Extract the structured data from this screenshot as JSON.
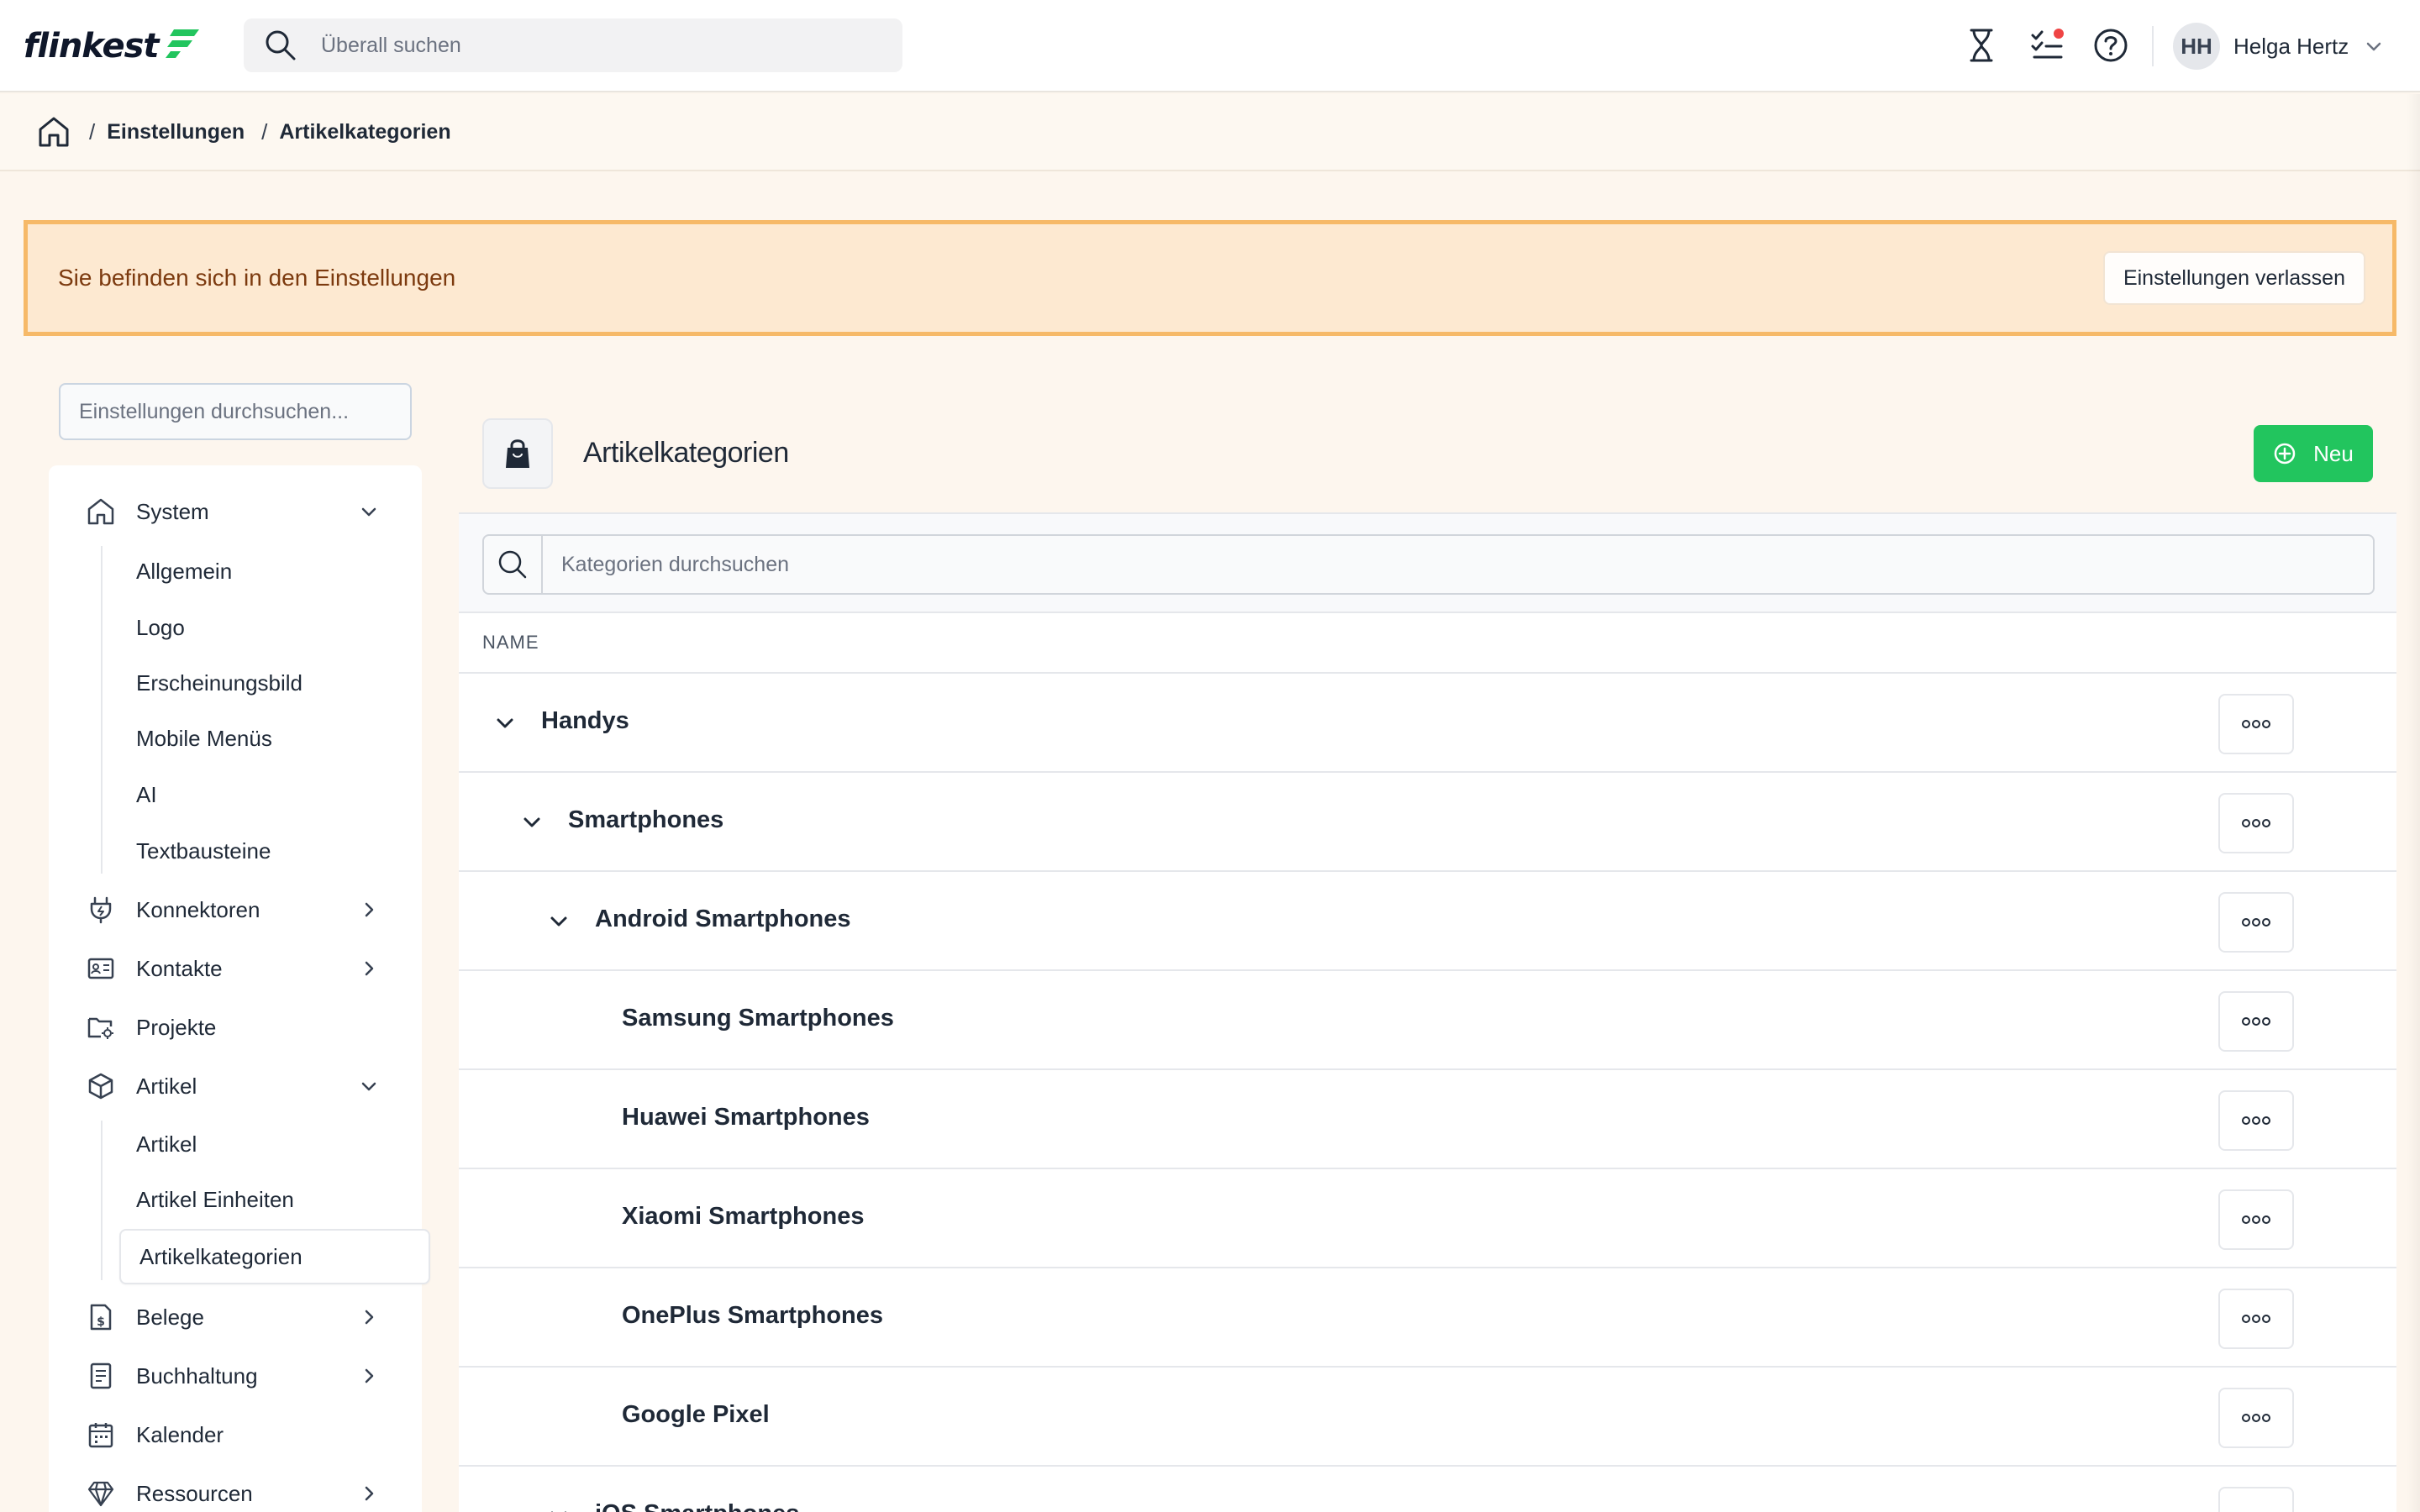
{
  "app": {
    "logo_text": "flinkest",
    "brand_color": "#22c55e"
  },
  "topbar": {
    "search_placeholder": "Überall suchen",
    "icons": [
      "hourglass-icon",
      "tasks-icon",
      "help-icon"
    ],
    "has_notification": true
  },
  "user": {
    "initials": "HH",
    "name": "Helga Hertz"
  },
  "breadcrumb": {
    "items": [
      "Einstellungen",
      "Artikelkategorien"
    ]
  },
  "banner": {
    "text": "Sie befinden sich in den Einstellungen",
    "button_label": "Einstellungen verlassen"
  },
  "sidebar": {
    "search_placeholder": "Einstellungen durchsuchen...",
    "system": {
      "label": "System",
      "children": [
        "Allgemein",
        "Logo",
        "Erscheinungsbild",
        "Mobile Menüs",
        "AI",
        "Textbausteine"
      ]
    },
    "items": {
      "konnektoren": "Konnektoren",
      "kontakte": "Kontakte",
      "projekte": "Projekte",
      "artikel": "Artikel",
      "belege": "Belege",
      "buchhaltung": "Buchhaltung",
      "kalender": "Kalender",
      "ressourcen": "Ressourcen"
    },
    "artikel_children": [
      "Artikel",
      "Artikel Einheiten",
      "Artikelkategorien"
    ],
    "active_item": "Artikelkategorien"
  },
  "main": {
    "title": "Artikelkategorien",
    "new_button_label": "Neu",
    "search_placeholder": "Kategorien durchsuchen",
    "column_header": "NAME",
    "rows": [
      {
        "label": "Handys",
        "depth": 0,
        "expanded": true
      },
      {
        "label": "Smartphones",
        "depth": 1,
        "expanded": true
      },
      {
        "label": "Android Smartphones",
        "depth": 2,
        "expanded": true
      },
      {
        "label": "Samsung Smartphones",
        "depth": 3,
        "expanded": null
      },
      {
        "label": "Huawei Smartphones",
        "depth": 3,
        "expanded": null
      },
      {
        "label": "Xiaomi Smartphones",
        "depth": 3,
        "expanded": null
      },
      {
        "label": "OnePlus Smartphones",
        "depth": 3,
        "expanded": null
      },
      {
        "label": "Google Pixel",
        "depth": 3,
        "expanded": null
      },
      {
        "label": "iOS Smartphones",
        "depth": 2,
        "expanded": true
      }
    ]
  }
}
